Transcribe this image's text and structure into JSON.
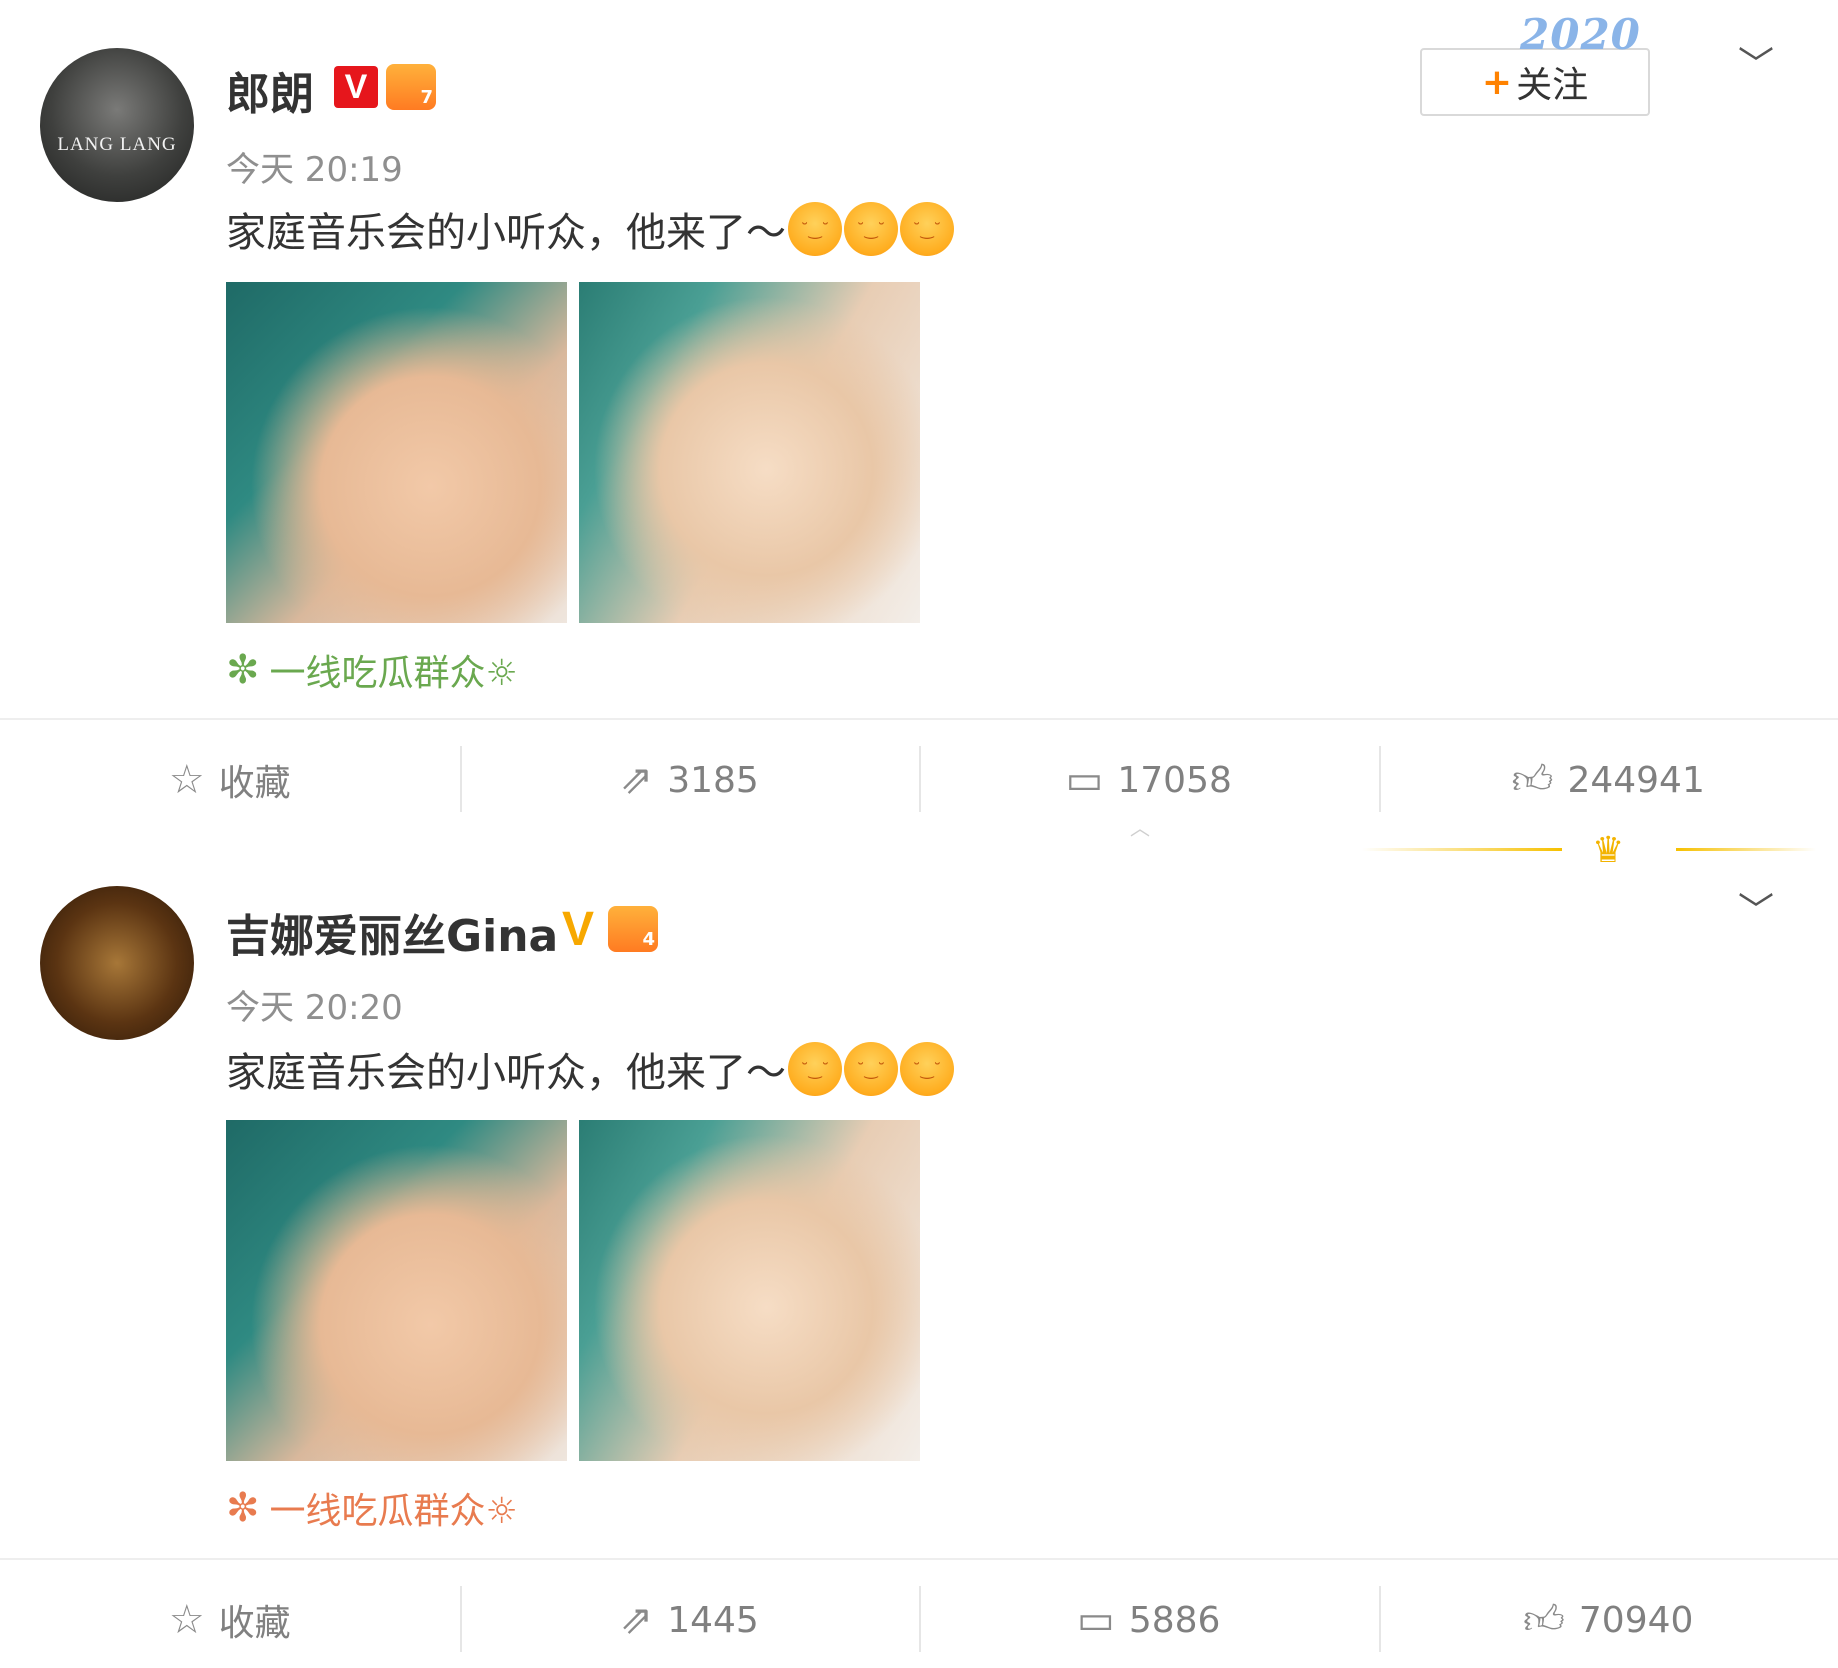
{
  "posts": [
    {
      "author": "郎朗",
      "avatar_text": "LANG LANG",
      "badge_v": "V",
      "badge_level": "7",
      "time": "今天 20:19",
      "text": "家庭音乐会的小听众，他来了～",
      "emoji_count": 3,
      "source": "一线吃瓜群众☼",
      "actions": {
        "favorite_label": "收藏",
        "repost_count": "3185",
        "comment_count": "17058",
        "like_count": "244941"
      },
      "follow_label": "关注"
    },
    {
      "author": "吉娜爱丽丝Gina",
      "badge_v": "V",
      "badge_level": "4",
      "time": "今天 20:20",
      "text": "家庭音乐会的小听众，他来了～",
      "emoji_count": 3,
      "source": "一线吃瓜群众☼",
      "actions": {
        "favorite_label": "收藏",
        "repost_count": "1445",
        "comment_count": "5886",
        "like_count": "70940"
      }
    }
  ],
  "sticker_text": "2020",
  "icons": {
    "favorite": "star-outline-icon",
    "repost": "share-arrow-icon",
    "comment": "comment-bubble-icon",
    "like": "thumbs-up-icon",
    "expand": "chevron-down-icon"
  },
  "colors": {
    "verified_red": "#e6161c",
    "verified_gold": "#f7a800",
    "follow_plus": "#ff8200",
    "source_green": "#6aa84f",
    "source_orange": "#e87b4f",
    "muted_text": "#808080"
  }
}
